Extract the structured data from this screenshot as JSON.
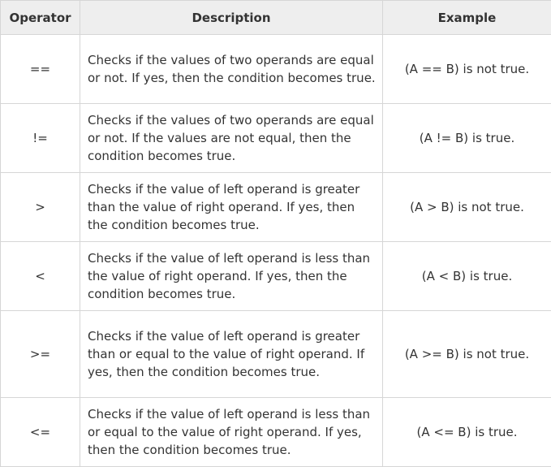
{
  "table": {
    "headers": {
      "operator": "Operator",
      "description": "Description",
      "example": "Example"
    },
    "rows": [
      {
        "operator": "==",
        "description": "Checks if the values of two operands are equal or not. If yes, then the condition becomes true.",
        "example": "(A == B) is not true."
      },
      {
        "operator": "!=",
        "description": "Checks if the values of two operands are equal or not. If the values are not equal, then the condition becomes true.",
        "example": "(A != B) is true."
      },
      {
        "operator": ">",
        "description": "Checks if the value of left operand is greater than the value of right operand. If yes, then the condition becomes true.",
        "example": "(A > B) is not true."
      },
      {
        "operator": "<",
        "description": "Checks if the value of left operand is less than the value of right operand. If yes, then the condition becomes true.",
        "example": "(A < B) is true."
      },
      {
        "operator": ">=",
        "description": "Checks if the value of left operand is greater than or equal to the value of right operand. If yes, then the condition becomes true.",
        "example": "(A >= B) is not true."
      },
      {
        "operator": "<=",
        "description": "Checks if the value of left operand is less than or equal to the value of right operand. If yes, then the condition becomes true.",
        "example": "(A <= B) is true."
      }
    ]
  }
}
